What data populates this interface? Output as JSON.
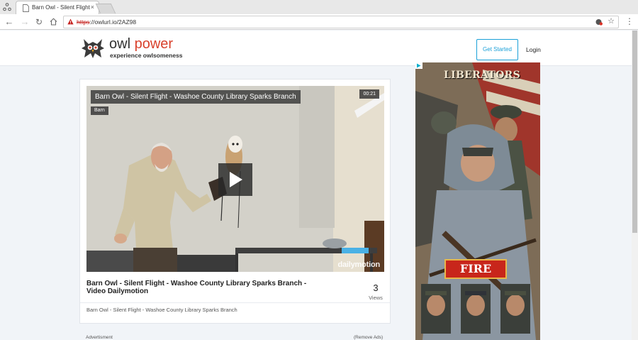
{
  "browser": {
    "tab_title": "Barn Owl - Silent Flight",
    "tab_close": "×",
    "url_scheme": "https",
    "url_rest": "://owlurl.io/2AZ98"
  },
  "site": {
    "logo_word1": "owl",
    "logo_word2": "power",
    "tagline": "experience owlsomeness",
    "get_started": "Get Started",
    "login": "Login"
  },
  "video": {
    "overlay_title": "Barn Owl - Silent Flight - Washoe County Library Sparks Branch",
    "tag": "Barn",
    "duration": "00:21",
    "watermark": "dailymotion",
    "title": "Barn Owl - Silent Flight - Washoe County Library Sparks Branch - Video Dailymotion",
    "views": "3",
    "views_label": "Views",
    "description": "Barn Owl - Silent Flight - Washoe County Library Sparks Branch"
  },
  "ads": {
    "label": "Advertisment",
    "remove": "(Remove Ads)",
    "banner_headline": "LIBERATORS",
    "banner_button": "FIRE"
  },
  "icons": {
    "app_menu": "apps-icon",
    "page": "page-icon",
    "back": "arrow-left-icon",
    "forward": "arrow-right-icon",
    "reload": "reload-icon",
    "home": "home-icon",
    "warning": "warning-icon",
    "extension": "extension-icon",
    "star": "star-icon",
    "menu": "kebab-menu-icon",
    "play": "play-icon",
    "adchoices": "adchoices-icon"
  },
  "colors": {
    "accent": "#1aa0d8",
    "brand_red": "#d9412c",
    "page_bg": "#f1f4f8"
  }
}
